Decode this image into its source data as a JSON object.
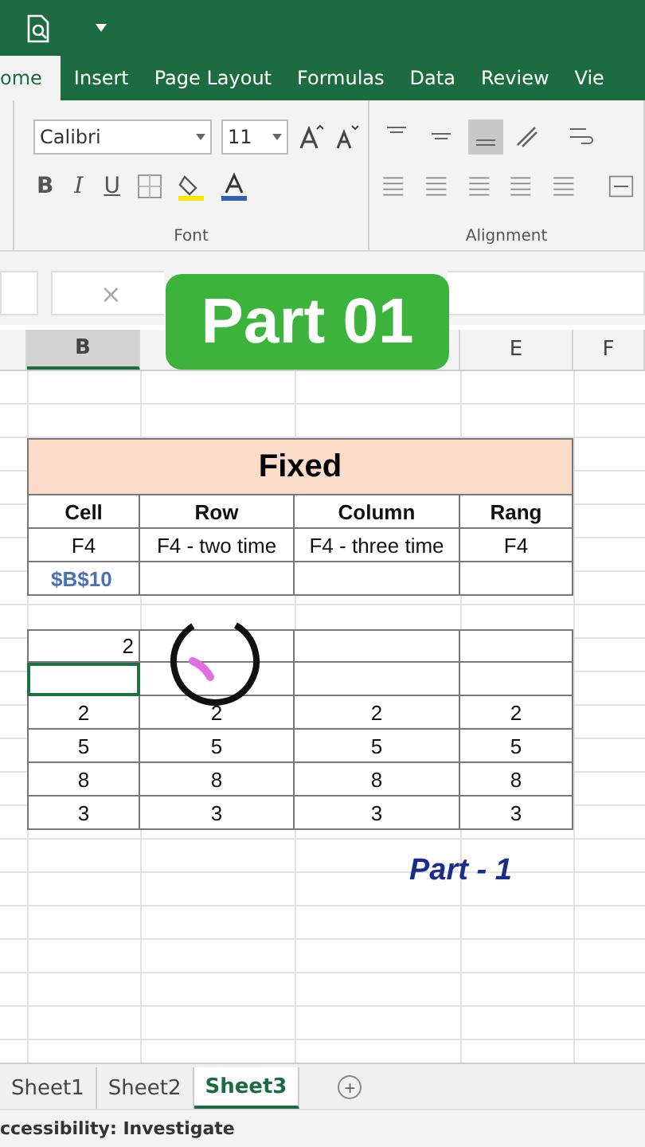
{
  "ribbon": {
    "tabs": [
      {
        "label": "ome",
        "selected": true
      },
      {
        "label": "Insert",
        "selected": false
      },
      {
        "label": "Page Layout",
        "selected": false
      },
      {
        "label": "Formulas",
        "selected": false
      },
      {
        "label": "Data",
        "selected": false
      },
      {
        "label": "Review",
        "selected": false
      },
      {
        "label": "Vie",
        "selected": false
      }
    ],
    "font_name": "Calibri",
    "font_size": "11",
    "bold": "B",
    "italic": "I",
    "underline": "U",
    "groups": [
      "Font",
      "Alignment"
    ]
  },
  "formula_bar": {
    "cancel": "×"
  },
  "column_headers": [
    {
      "label": "B",
      "selected": true
    },
    {
      "label": "E",
      "selected": false
    },
    {
      "label": "F",
      "selected": false
    }
  ],
  "banner": "Part 01",
  "sheet": {
    "title": "Fixed",
    "headers": [
      "Cell",
      "Row",
      "Column",
      "Rang"
    ],
    "rows": [
      [
        "F4",
        "F4 -  two time",
        "F4 - three time",
        "F4"
      ]
    ],
    "reference": "$B$10",
    "entry": "2",
    "values": [
      [
        "2",
        "2",
        "2",
        "2"
      ],
      [
        "5",
        "5",
        "5",
        "5"
      ],
      [
        "8",
        "8",
        "8",
        "8"
      ],
      [
        "3",
        "3",
        "3",
        "3"
      ]
    ]
  },
  "caption": "Part - 1",
  "sheet_tabs": [
    {
      "label": "Sheet1",
      "selected": false
    },
    {
      "label": "Sheet2",
      "selected": false
    },
    {
      "label": "Sheet3",
      "selected": true
    }
  ],
  "add_sheet": "+",
  "status": "ccessibility: Investigate"
}
